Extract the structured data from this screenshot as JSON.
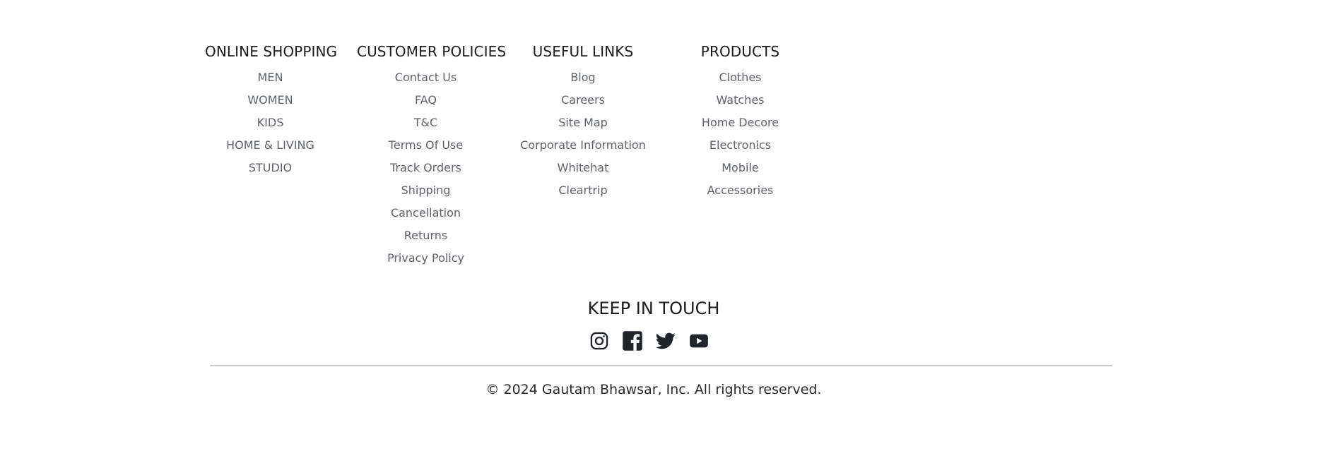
{
  "footer": {
    "columns": [
      {
        "heading": "ONLINE SHOPPING",
        "links": [
          "MEN",
          "WOMEN",
          "KIDS",
          "HOME & LIVING",
          "STUDIO"
        ]
      },
      {
        "heading": "CUSTOMER POLICIES",
        "links": [
          "Contact Us",
          "FAQ",
          "T&C",
          "Terms Of Use",
          "Track Orders",
          "Shipping",
          "Cancellation",
          "Returns",
          "Privacy Policy"
        ]
      },
      {
        "heading": "USEFUL LINKS",
        "links": [
          "Blog",
          "Careers",
          "Site Map",
          "Corporate Information",
          "Whitehat",
          "Cleartrip"
        ]
      },
      {
        "heading": "PRODUCTS",
        "links": [
          "Clothes",
          "Watches",
          "Home Decore",
          "Electronics",
          "Mobile",
          "Accessories"
        ]
      }
    ],
    "keep_in_touch": "KEEP IN TOUCH",
    "socials": [
      {
        "icon": "instagram-icon"
      },
      {
        "icon": "facebook-icon"
      },
      {
        "icon": "twitter-icon"
      },
      {
        "icon": "youtube-icon"
      }
    ],
    "copyright": "© 2024 Gautam Bhawsar, Inc. All rights reserved.",
    "colors": {
      "heading": "#1c1c1c",
      "link": "#5f6368",
      "icon": "#212529",
      "divider": "#c8c8c8"
    }
  }
}
